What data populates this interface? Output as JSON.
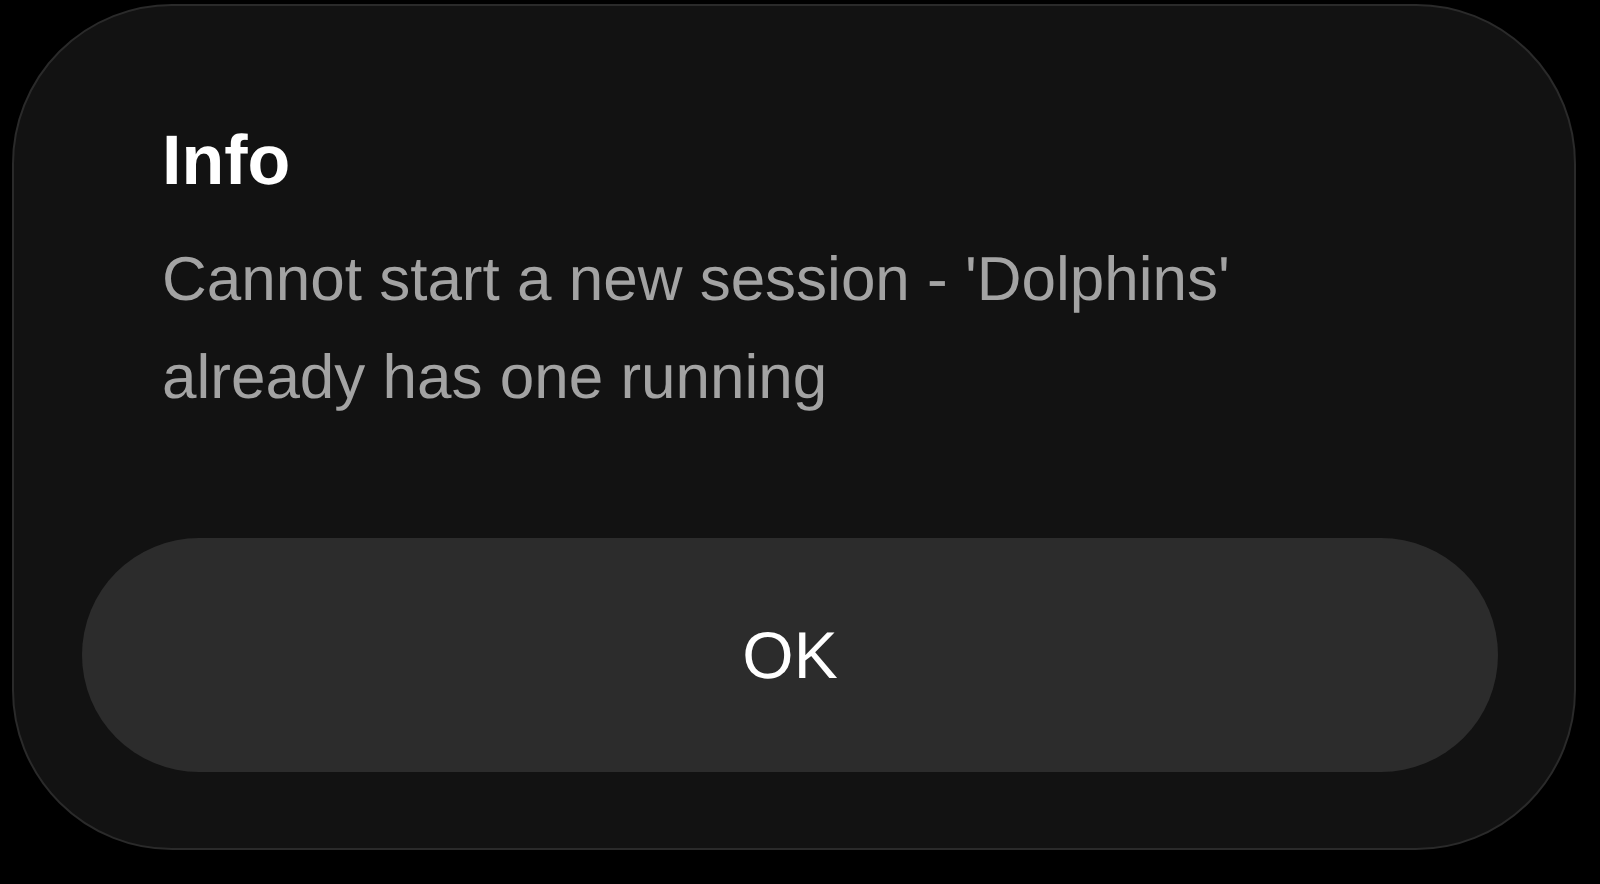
{
  "dialog": {
    "title": "Info",
    "message": "Cannot start a new session - 'Dolphins' already has one running",
    "buttons": [
      "OK"
    ]
  }
}
